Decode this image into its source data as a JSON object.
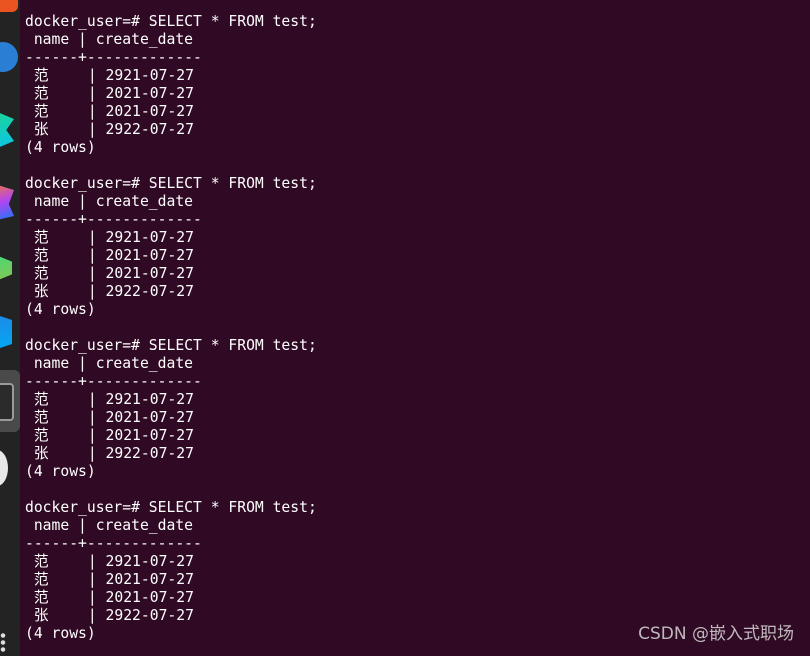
{
  "query_blocks": [
    {
      "prompt": "docker_user=# SELECT * FROM test;",
      "header": " name | create_date",
      "divider": "------+-------------",
      "rows": [
        {
          "name": "范",
          "date": "2921-07-27"
        },
        {
          "name": "范",
          "date": "2021-07-27"
        },
        {
          "name": "范",
          "date": "2021-07-27"
        },
        {
          "name": "张",
          "date": "2922-07-27"
        }
      ],
      "footer": "(4 rows)"
    },
    {
      "prompt": "docker_user=# SELECT * FROM test;",
      "header": " name | create_date",
      "divider": "------+-------------",
      "rows": [
        {
          "name": "范",
          "date": "2921-07-27"
        },
        {
          "name": "范",
          "date": "2021-07-27"
        },
        {
          "name": "范",
          "date": "2021-07-27"
        },
        {
          "name": "张",
          "date": "2922-07-27"
        }
      ],
      "footer": "(4 rows)"
    },
    {
      "prompt": "docker_user=# SELECT * FROM test;",
      "header": " name | create_date",
      "divider": "------+-------------",
      "rows": [
        {
          "name": "范",
          "date": "2921-07-27"
        },
        {
          "name": "范",
          "date": "2021-07-27"
        },
        {
          "name": "范",
          "date": "2021-07-27"
        },
        {
          "name": "张",
          "date": "2922-07-27"
        }
      ],
      "footer": "(4 rows)"
    },
    {
      "prompt": "docker_user=# SELECT * FROM test;",
      "header": " name | create_date",
      "divider": "------+-------------",
      "rows": [
        {
          "name": "范",
          "date": "2921-07-27"
        },
        {
          "name": "范",
          "date": "2021-07-27"
        },
        {
          "name": "范",
          "date": "2021-07-27"
        },
        {
          "name": "张",
          "date": "2922-07-27"
        }
      ],
      "footer": "(4 rows)"
    }
  ],
  "row_separator": "|",
  "watermark": "CSDN @嵌入式职场",
  "colors": {
    "terminal_background": "#300a24",
    "terminal_text": "#ffffff",
    "dock_background": "#232323"
  },
  "dock_icons": [
    "ubuntu-software-icon",
    "browser-icon",
    "pycharm-icon",
    "jetbrains-toolbox-icon",
    "android-studio-icon",
    "clion-icon",
    "terminal-icon",
    "disc-icon",
    "app-grid-icon"
  ]
}
